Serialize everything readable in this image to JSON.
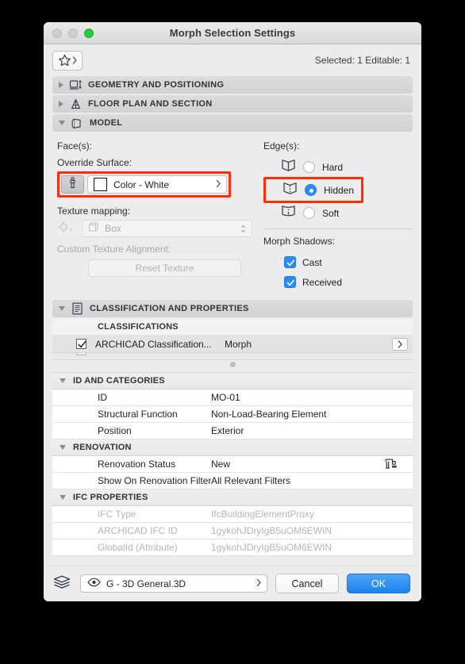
{
  "window": {
    "title": "Morph Selection Settings",
    "traffic_lights": [
      "close",
      "minimize",
      "zoom"
    ]
  },
  "favorites": {
    "icon": "star-icon",
    "selection_info": "Selected: 1 Editable: 1"
  },
  "sections": [
    {
      "label": "GEOMETRY AND POSITIONING",
      "icon": "geometry-icon",
      "expanded": false
    },
    {
      "label": "FLOOR PLAN AND SECTION",
      "icon": "floorplan-icon",
      "expanded": false
    },
    {
      "label": "MODEL",
      "icon": "model-icon",
      "expanded": true
    }
  ],
  "model": {
    "faces": {
      "group_label": "Face(s):",
      "override_surface_label": "Override Surface:",
      "surface_button_icon": "paintbrush-icon",
      "surface_value": "Color - White",
      "surface_swatch_color": "#ffffff",
      "highlighted": true,
      "texture_mapping_label": "Texture mapping:",
      "texture_mapping_icon": "paint-bucket-icon",
      "texture_mapping_value": "Box",
      "custom_texture_alignment_label": "Custom Texture Alignment:",
      "reset_texture_label": "Reset Texture"
    },
    "edges": {
      "group_label": "Edge(s):",
      "options": [
        {
          "label": "Hard",
          "icon": "edge-hard-icon",
          "selected": false,
          "highlighted": false
        },
        {
          "label": "Hidden",
          "icon": "edge-hidden-icon",
          "selected": true,
          "highlighted": true
        },
        {
          "label": "Soft",
          "icon": "edge-soft-icon",
          "selected": false,
          "highlighted": false
        }
      ]
    },
    "shadows": {
      "group_label": "Morph Shadows:",
      "options": [
        {
          "label": "Cast",
          "checked": true
        },
        {
          "label": "Received",
          "checked": true
        }
      ]
    }
  },
  "classification_section": {
    "label": "CLASSIFICATION AND PROPERTIES",
    "icon": "list-icon",
    "expanded": true,
    "classifications_header": "CLASSIFICATIONS",
    "rows": [
      {
        "checked": true,
        "name": "ARCHICAD Classification...",
        "value": "Morph",
        "has_chevron": true
      }
    ]
  },
  "property_groups": [
    {
      "name": "ID AND CATEGORIES",
      "expanded": true,
      "rows": [
        {
          "name": "ID",
          "value": "MO-01",
          "dim": false
        },
        {
          "name": "Structural Function",
          "value": "Non-Load-Bearing Element",
          "dim": false
        },
        {
          "name": "Position",
          "value": "Exterior",
          "dim": false
        }
      ]
    },
    {
      "name": "RENOVATION",
      "expanded": true,
      "rows": [
        {
          "name": "Renovation Status",
          "value": "New",
          "dim": false,
          "icon": "renovation-icon"
        },
        {
          "name": "Show On Renovation Filter",
          "value": "All Relevant Filters",
          "dim": false
        }
      ]
    },
    {
      "name": "IFC PROPERTIES",
      "expanded": true,
      "rows": [
        {
          "name": "IFC Type",
          "value": "IfcBuildingElementProxy",
          "dim": true
        },
        {
          "name": "ARCHICAD IFC ID",
          "value": "1gykohJDryIgB5uOM6EWIN",
          "dim": true
        },
        {
          "name": "GlobalId (Attribute)",
          "value": "1gykohJDryIgB5uOM6EWIN",
          "dim": true
        }
      ]
    }
  ],
  "footer": {
    "layers_icon": "layers-icon",
    "eye_icon": "eye-icon",
    "layer_value": "G - 3D General.3D",
    "cancel_label": "Cancel",
    "ok_label": "OK"
  },
  "colors": {
    "highlight": "#ff2d09",
    "accent": "#2a8cf4",
    "ok_button": "#1d82f0"
  }
}
